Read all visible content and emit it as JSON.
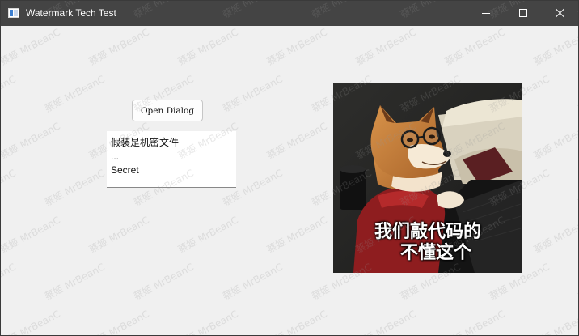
{
  "window": {
    "title": "Watermark Tech Test",
    "controls": {
      "minimize": "minimize-icon",
      "maximize": "maximize-icon",
      "close": "close-icon"
    }
  },
  "main": {
    "open_dialog_label": "Open Dialog",
    "text_box_lines": [
      "假装是机密文件",
      "...",
      "Secret"
    ],
    "meme_caption_line1": "我们敲代码的",
    "meme_caption_line2": "不懂这个"
  },
  "watermark": {
    "text": "蔡姬 MrBeanC"
  },
  "colors": {
    "titlebar": "#444444",
    "window_background": "#f0f0f0"
  }
}
